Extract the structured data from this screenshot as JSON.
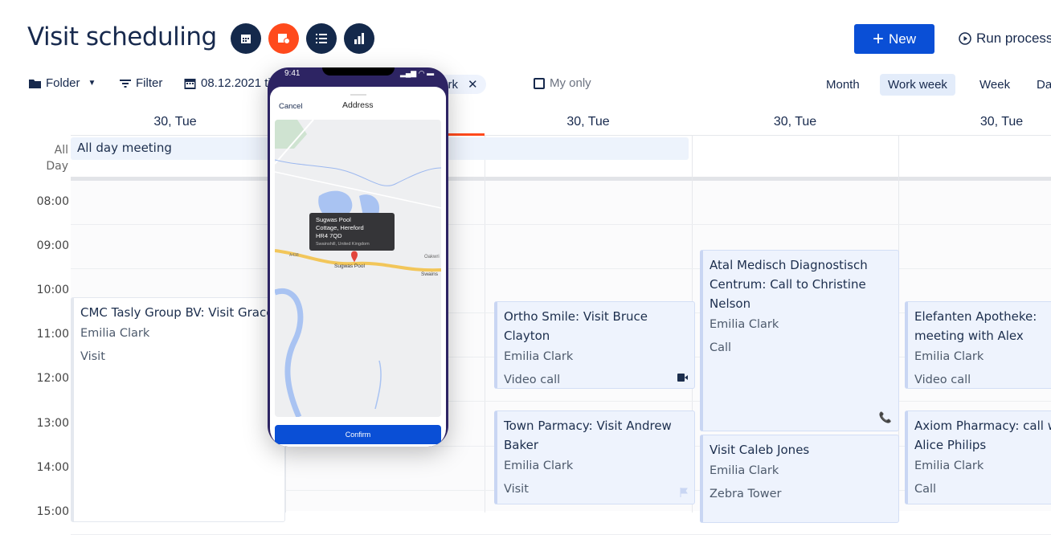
{
  "header": {
    "title": "Visit scheduling",
    "new_label": "New",
    "run_label": "Run process",
    "view_icons": [
      "calendar-icon",
      "calendar-location-icon",
      "list-icon",
      "bar-chart-icon"
    ],
    "active_view_icon": "calendar-location-icon"
  },
  "toolbar": {
    "folder": "Folder",
    "filter": "Filter",
    "date": "08.12.2021 ti",
    "user_chip": "Emilia Clark",
    "my_only": "My only",
    "views": [
      "Month",
      "Work week",
      "Week",
      "Day"
    ],
    "selected_view": "Work week"
  },
  "calendar": {
    "columns": [
      "30, Tue",
      "30, Tue",
      "30, Tue",
      "30, Tue",
      "30, Tue"
    ],
    "all_day_label": "All Day",
    "all_day_event": "All day meeting",
    "hours": [
      "08:00",
      "09:00",
      "10:00",
      "11:00",
      "12:00",
      "13:00",
      "14:00",
      "15:00"
    ],
    "events": [
      {
        "title": "CMC Tasly Group BV: Visit Grace",
        "person": "Emilia Clark",
        "type": "Visit"
      },
      {
        "title": "Ortho Smile: Visit Bruce Clayton",
        "person": "Emilia Clark",
        "type": "Video call",
        "icon": "video-icon"
      },
      {
        "title": "Town Parmacy: Visit Andrew Baker",
        "person": "Emilia Clark",
        "type": "Visit",
        "icon": "flag-icon"
      },
      {
        "title": "Atal Medisch Diagnostisch Centrum: Call to Christine Nelson",
        "person": "Emilia Clark",
        "type": "Call",
        "icon": "phone-icon"
      },
      {
        "title": "Visit Caleb Jones",
        "person": "Emilia Clark",
        "type": "Zebra Tower"
      },
      {
        "title": "Elefanten Apotheke: meeting with Alex",
        "person": "Emilia Clark",
        "type": "Video call"
      },
      {
        "title": "Axiom Pharmacy: call with Alice Philips",
        "person": "Emilia Clark",
        "type": "Call"
      }
    ]
  },
  "phone": {
    "time": "9:41",
    "cancel": "Cancel",
    "title": "Address",
    "map": {
      "popup_line1": "Sugwas Pool",
      "popup_line2": "Cottage, Hereford",
      "popup_line3": "HR4 7QD",
      "popup_sub": "Swainshill, United Kingdom",
      "pin_label": "Sugwas Pool",
      "road_label": "A438",
      "place1": "Oakwri",
      "place2": "Swains"
    },
    "confirm": "Confirm"
  },
  "colors": {
    "primary": "#0a4fd6",
    "accent": "#ff4a1c",
    "navy": "#14294b",
    "event_bg": "#eef3fd"
  }
}
